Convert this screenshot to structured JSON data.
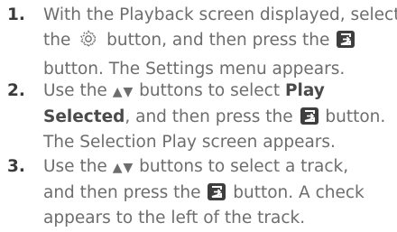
{
  "steps": [
    {
      "number": "1.",
      "lines": [
        [
          "With the Playback screen displayed, select"
        ],
        [
          "the ",
          " button, and then press the "
        ],
        [
          "button. The Settings menu appears."
        ]
      ]
    },
    {
      "number": "2.",
      "lines": [
        [
          "Use the ",
          " buttons to select ",
          "Play"
        ],
        [
          "Selected",
          ", and then press the ",
          " button."
        ],
        [
          "The Selection Play screen appears."
        ]
      ]
    },
    {
      "number": "3.",
      "lines": [
        [
          "Use the ",
          " buttons to select a track,"
        ],
        [
          "and then press the ",
          " button. A check"
        ],
        [
          "appears to the left of the track."
        ]
      ]
    }
  ],
  "icons": {
    "settings": "gear-icon",
    "enter": "enter-icon",
    "up_down": "▲▼"
  }
}
